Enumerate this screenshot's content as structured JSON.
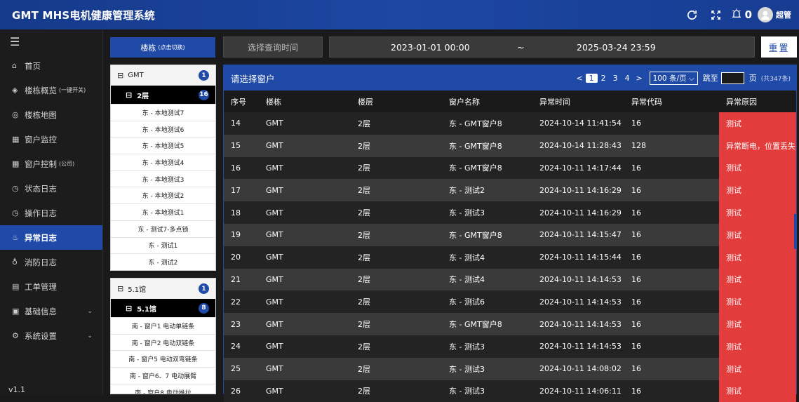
{
  "header": {
    "title": "GMT MHS电机健康管理系统",
    "alarm_count": "0",
    "user": "超管"
  },
  "sidebar": {
    "items": [
      {
        "label": "首页",
        "icon": "⌂"
      },
      {
        "label": "楼栋概览",
        "small": "(一键开关)",
        "icon": "◈"
      },
      {
        "label": "楼栋地图",
        "icon": "◎"
      },
      {
        "label": "窗户监控",
        "icon": "▦"
      },
      {
        "label": "窗户控制",
        "small": "(公司)",
        "icon": "▦"
      },
      {
        "label": "状态日志",
        "icon": "◷"
      },
      {
        "label": "操作日志",
        "icon": "◷"
      },
      {
        "label": "异常日志",
        "icon": "♨"
      },
      {
        "label": "消防日志",
        "icon": "♁"
      },
      {
        "label": "工单管理",
        "icon": "▤"
      },
      {
        "label": "基础信息",
        "icon": "▣"
      },
      {
        "label": "系统设置",
        "icon": "⚙"
      }
    ],
    "version": "v1.1"
  },
  "toolbar": {
    "building_label": "楼栋",
    "building_hint": "(点击切换)",
    "query_label": "选择查询时间",
    "date_start": "2023-01-01 00:00",
    "date_sep": "~",
    "date_end": "2025-03-24 23:59",
    "reset_label": "重置"
  },
  "tree": {
    "groups": [
      {
        "name": "GMT",
        "count": "1",
        "sub": "2层",
        "sub_count": "16",
        "leaves": [
          "东 - 本地测试7",
          "东 - 本地测试6",
          "东 - 本地测试5",
          "东 - 本地测试4",
          "东 - 本地测试3",
          "东 - 本地测试2",
          "东 - 本地测试1",
          "东 - 测试7-多点锁",
          "东 - 测试1",
          "东 - 测试2"
        ]
      },
      {
        "name": "5.1馆",
        "count": "1",
        "sub": "5.1馆",
        "sub_count": "8",
        "leaves": [
          "南 - 窗户1 电动单链条",
          "南 - 窗户2 电动双链条",
          "南 - 窗户5 电动双弯链条",
          "南 - 窗户6、7 电动展臂",
          "南 - 窗户8 电动推拉"
        ]
      }
    ]
  },
  "panel": {
    "title": "请选择窗户",
    "pager": {
      "prev": "<",
      "pages": [
        "1",
        "2",
        "3",
        "4"
      ],
      "next": ">",
      "page_size": "100 条/页",
      "jump_label": "跳至",
      "page_unit": "页",
      "total": "(共347条)"
    },
    "columns": [
      "序号",
      "楼栋",
      "楼层",
      "窗户名称",
      "异常时间",
      "异常代码",
      "异常原因"
    ],
    "rows": [
      [
        "14",
        "GMT",
        "2层",
        "东 - GMT窗户8",
        "2024-10-14 11:41:54",
        "16",
        "测试"
      ],
      [
        "15",
        "GMT",
        "2层",
        "东 - GMT窗户8",
        "2024-10-14 11:28:43",
        "128",
        "异常断电，位置丢失"
      ],
      [
        "16",
        "GMT",
        "2层",
        "东 - GMT窗户8",
        "2024-10-11 14:17:44",
        "16",
        "测试"
      ],
      [
        "17",
        "GMT",
        "2层",
        "东 - 测试2",
        "2024-10-11 14:16:29",
        "16",
        "测试"
      ],
      [
        "18",
        "GMT",
        "2层",
        "东 - 测试3",
        "2024-10-11 14:16:29",
        "16",
        "测试"
      ],
      [
        "19",
        "GMT",
        "2层",
        "东 - GMT窗户8",
        "2024-10-11 14:15:47",
        "16",
        "测试"
      ],
      [
        "20",
        "GMT",
        "2层",
        "东 - 测试4",
        "2024-10-11 14:15:44",
        "16",
        "测试"
      ],
      [
        "21",
        "GMT",
        "2层",
        "东 - 测试4",
        "2024-10-11 14:14:53",
        "16",
        "测试"
      ],
      [
        "22",
        "GMT",
        "2层",
        "东 - 测试6",
        "2024-10-11 14:14:53",
        "16",
        "测试"
      ],
      [
        "23",
        "GMT",
        "2层",
        "东 - GMT窗户8",
        "2024-10-11 14:14:53",
        "16",
        "测试"
      ],
      [
        "24",
        "GMT",
        "2层",
        "东 - 测试3",
        "2024-10-11 14:14:53",
        "16",
        "测试"
      ],
      [
        "25",
        "GMT",
        "2层",
        "东 - 测试3",
        "2024-10-11 14:08:02",
        "16",
        "测试"
      ],
      [
        "26",
        "GMT",
        "2层",
        "东 - 测试3",
        "2024-10-11 14:06:11",
        "16",
        "测试"
      ]
    ]
  },
  "colors": {
    "brand": "#1f4aa8",
    "alert": "#e23c3c"
  }
}
